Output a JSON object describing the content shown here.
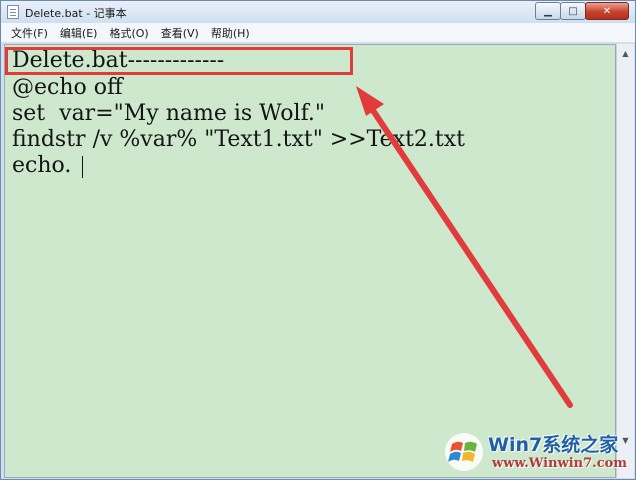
{
  "window": {
    "title": "Delete.bat - 记事本"
  },
  "controls": {
    "minimize_glyph": "▁",
    "maximize_glyph": "□",
    "close_glyph": "✕"
  },
  "menu": {
    "items": [
      {
        "label": "文件(F)"
      },
      {
        "label": "编辑(E)"
      },
      {
        "label": "格式(O)"
      },
      {
        "label": "查看(V)"
      },
      {
        "label": "帮助(H)"
      }
    ]
  },
  "editor": {
    "lines": [
      "Delete.bat-------------",
      "@echo off",
      "set  var=\"My name is Wolf.\"",
      "findstr /v %var% \"Text1.txt\" >>Text2.txt",
      "echo."
    ],
    "background": "#cde8cc"
  },
  "annotation": {
    "color": "#e23b3b"
  },
  "watermark": {
    "brand": "Win7系统之家",
    "url": "www.Winwin7.com"
  }
}
